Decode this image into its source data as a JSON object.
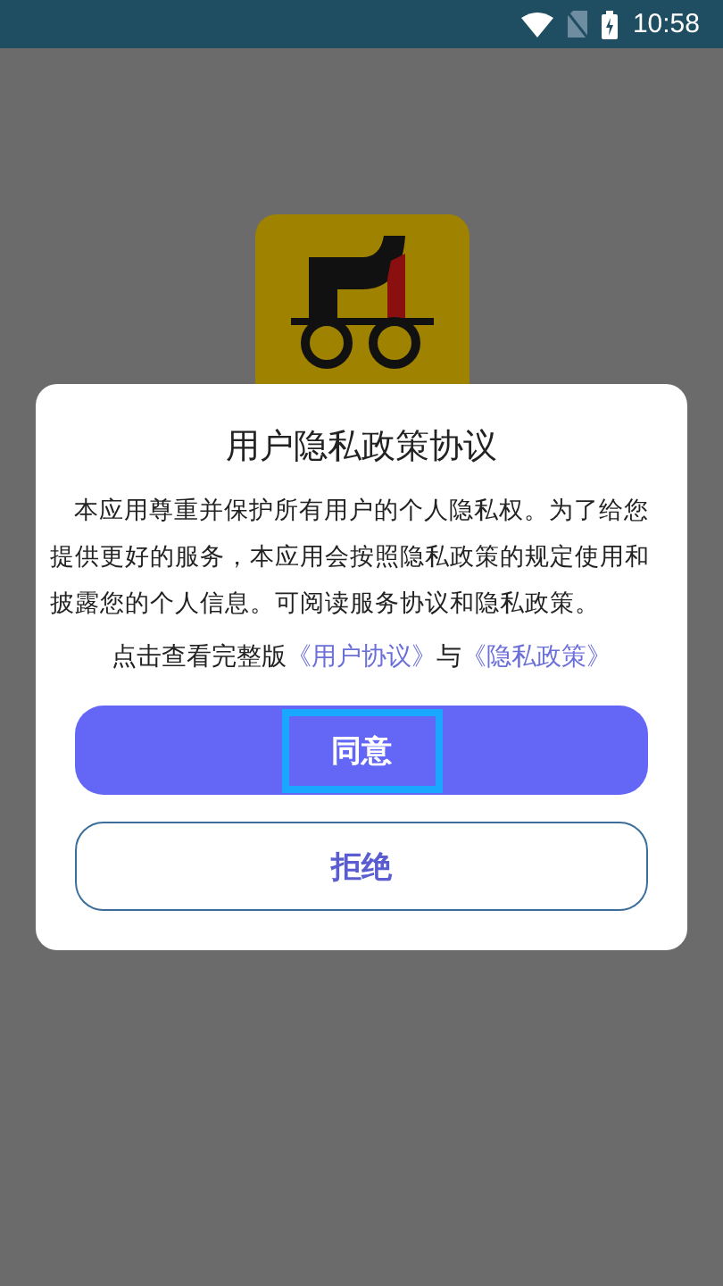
{
  "status_bar": {
    "time": "10:58"
  },
  "dialog": {
    "title": "用户隐私政策协议",
    "body": "本应用尊重并保护所有用户的个人隐私权。为了给您提供更好的服务，本应用会按照隐私政策的规定使用和披露您的个人信息。可阅读服务协议和隐私政策。",
    "links_line": {
      "prefix": "点击查看完整版",
      "link_1": "《用户协议》",
      "joiner": "与",
      "link_2": "《隐私政策》"
    },
    "buttons": [
      {
        "label": "同意",
        "kind": "primary",
        "focused": true
      },
      {
        "label": "拒绝",
        "kind": "outline",
        "focused": false
      }
    ]
  }
}
